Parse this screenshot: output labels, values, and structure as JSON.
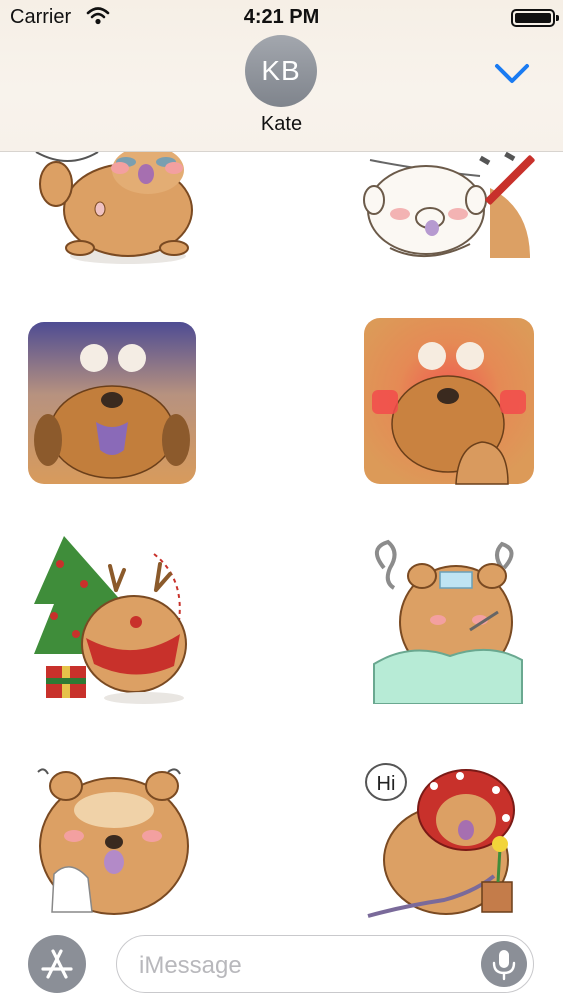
{
  "status_bar": {
    "carrier": "Carrier",
    "time": "4:21 PM"
  },
  "conversation": {
    "avatar_initials": "KB",
    "contact_name": "Kate"
  },
  "stickers": [
    {
      "name": "Chow chow with speech bubble"
    },
    {
      "name": "Chow chow sketch with red pencil"
    },
    {
      "name": "Chow chow dusk card"
    },
    {
      "name": "Chow chow blushing card"
    },
    {
      "name": "Chow chow Christmas reindeer"
    },
    {
      "name": "Chow chow sick with thermometer"
    },
    {
      "name": "Chow chow crying with tissue"
    },
    {
      "name": "Chow chow watering flower",
      "speech_text": "Hi"
    }
  ],
  "input_bar": {
    "placeholder": "iMessage"
  },
  "colors": {
    "accent": "#1a7bf2",
    "fur": "#dca064",
    "header_bg": "#f7f1ea",
    "button_gray": "#8b8f97"
  },
  "icons": [
    "wifi-icon",
    "battery-icon",
    "chevron-down-icon",
    "app-store-icon",
    "microphone-icon"
  ]
}
